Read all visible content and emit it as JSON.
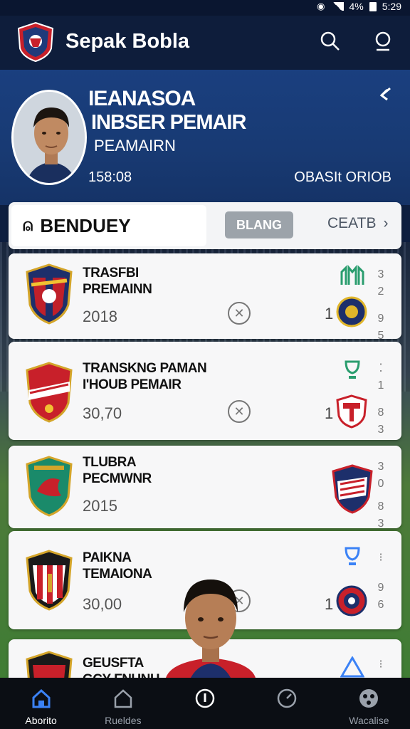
{
  "status_bar": {
    "time": "5:29",
    "battery": "4%"
  },
  "app": {
    "title": "Sepak Bobla"
  },
  "hero": {
    "title_line1": "IEANASOA",
    "title_line2": "INBSER PEMAIR",
    "subtitle": "PEAMAIRN",
    "time": "158:08",
    "right_text": "OBASIt ORIOB"
  },
  "filter": {
    "search_label": "BENDUEY",
    "chip_label": "BLANG",
    "create_label": "CEATB"
  },
  "cards": [
    {
      "title1": "TRASFBI",
      "title2": "PREMAINN",
      "year": "2018",
      "count": "1",
      "side1": "3",
      "side2": "2",
      "side3": "9",
      "side4": "5"
    },
    {
      "title1": "TRANSKNG PAMAN",
      "title2": "I'HOUB PEMAIR",
      "year": "30,70",
      "count": "1",
      "side1": "⁚",
      "side2": "1",
      "side3": "8",
      "side4": "3"
    },
    {
      "title1": "TLUBRA",
      "title2": "PECMWNR",
      "year": "2015",
      "count": "",
      "side1": "3",
      "side2": "0",
      "side3": "8",
      "side4": "3"
    },
    {
      "title1": "PAIKNA",
      "title2": "TEMAIONA",
      "year": "30,00",
      "count": "1",
      "side1": "⁝",
      "side2": "",
      "side3": "9",
      "side4": "6"
    },
    {
      "title1": "GEUSFTA",
      "title2": "GCY FNUNH",
      "year": "",
      "count": "",
      "side1": "⁝",
      "side2": "",
      "side3": "",
      "side4": ""
    }
  ],
  "nav": [
    {
      "label": "Aborito",
      "icon": "home-icon",
      "active": true
    },
    {
      "label": "Rueldes",
      "icon": "home-outline-icon",
      "active": false
    },
    {
      "label": "",
      "icon": "clock-icon",
      "active": false
    },
    {
      "label": "",
      "icon": "timer-icon",
      "active": false
    },
    {
      "label": "Wacalise",
      "icon": "ball-icon",
      "active": false
    }
  ],
  "colors": {
    "header": "#0e1d3b",
    "hero": "#1a3f7f",
    "accent_blue": "#3b82f6"
  }
}
